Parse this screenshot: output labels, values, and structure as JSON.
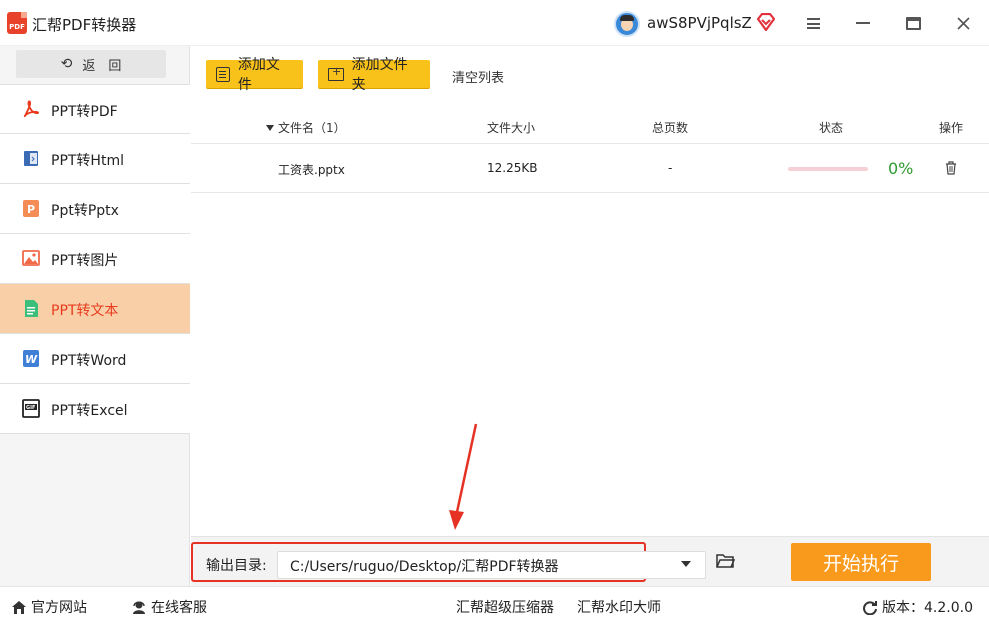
{
  "app": {
    "title": "汇帮PDF转换器",
    "logo_text": "PDF",
    "username": "awS8PVjPqlsZ"
  },
  "sidebar": {
    "back_label": "返　回",
    "items": [
      {
        "label": "PPT转PDF",
        "icon": "pdf-icon",
        "color": "#e83b1e"
      },
      {
        "label": "PPT转Html",
        "icon": "html-icon",
        "color": "#3b6bb5"
      },
      {
        "label": "Ppt转Pptx",
        "icon": "pptx-icon",
        "color": "#f58b55"
      },
      {
        "label": "PPT转图片",
        "icon": "image-icon",
        "color": "#f06a4a"
      },
      {
        "label": "PPT转文本",
        "icon": "text-file-icon",
        "color": "#3bbf7a",
        "active": true
      },
      {
        "label": "PPT转Word",
        "icon": "word-icon",
        "color": "#3f7fd6"
      },
      {
        "label": "PPT转Excel",
        "icon": "gif-icon",
        "color": "#222222"
      }
    ]
  },
  "toolbar": {
    "add_file": "添加文件",
    "add_folder": "添加文件夹",
    "clear_list": "清空列表"
  },
  "table": {
    "headers": {
      "name": "文件名（1）",
      "size": "文件大小",
      "pages": "总页数",
      "status": "状态",
      "op": "操作"
    },
    "rows": [
      {
        "name": "工资表.pptx",
        "size": "12.25KB",
        "pages": "-",
        "progress": 0,
        "percent": "0%"
      }
    ]
  },
  "output": {
    "label": "输出目录:",
    "path": "C:/Users/ruguo/Desktop/汇帮PDF转换器",
    "start_button": "开始执行"
  },
  "statusbar": {
    "website": "官方网站",
    "service": "在线客服",
    "compressor": "汇帮超级压缩器",
    "watermark": "汇帮水印大师",
    "version": "版本：4.2.0.0"
  },
  "colors": {
    "accent_yellow": "#f9c21a",
    "start_orange": "#fa9a1c",
    "active_nav_bg": "#f9cfa7",
    "active_nav_text": "#e83b1e",
    "highlight_red": "#e53224",
    "percent_green": "#2f9a31"
  }
}
